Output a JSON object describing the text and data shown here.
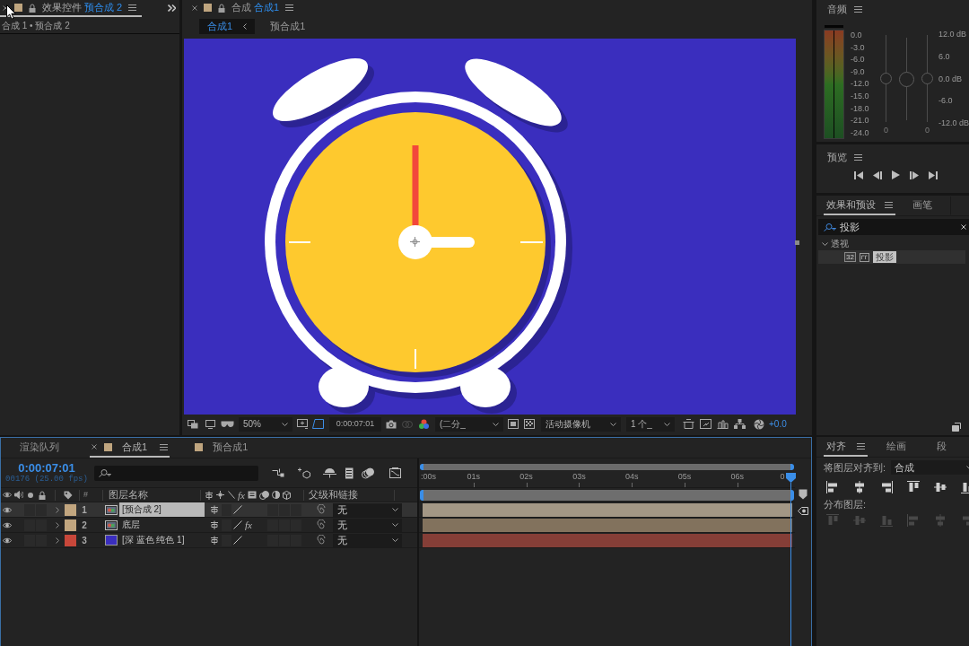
{
  "effect_controls": {
    "title": "效果控件",
    "target": "预合成 2",
    "selected": true,
    "breadcrumb": "合成 1 • 预合成 2"
  },
  "composition": {
    "title": "合成",
    "target": "合成1",
    "selected": false,
    "tabs": [
      {
        "label": "合成1",
        "selected": true
      },
      {
        "label": "预合成1",
        "selected": false
      }
    ],
    "toolbar": {
      "zoom": "50%",
      "timecode": "0:00:07:01",
      "resolution": "(二分_",
      "camera": "活动摄像机",
      "views": "1 个_",
      "exposure": "+0.0"
    }
  },
  "audio": {
    "title": "音频",
    "meter_scale": [
      "0.0",
      "-3.0",
      "-6.0",
      "-9.0",
      "-12.0",
      "-15.0",
      "-18.0",
      "-21.0",
      "-24.0"
    ],
    "sliders": [
      {
        "kind": "channel",
        "level": 0.5,
        "value": "0"
      },
      {
        "kind": "master",
        "level": 0.5
      },
      {
        "kind": "channel",
        "level": 0.5,
        "value": "0"
      }
    ],
    "gain_scale": [
      "12.0 dB",
      "6.0",
      "0.0 dB",
      "-6.0",
      "-12.0 dB"
    ]
  },
  "preview": {
    "title": "预览"
  },
  "effects_presets": {
    "tabs": [
      {
        "label": "效果和预设",
        "selected": true
      },
      {
        "label": "画笔",
        "selected": false
      }
    ],
    "search": {
      "value": "投影"
    },
    "tree": [
      {
        "label": "透视",
        "expanded": true,
        "children": [
          {
            "label": "投影",
            "badge": "32",
            "selected": true
          }
        ]
      }
    ]
  },
  "timeline": {
    "tabs": [
      {
        "label": "渲染队列",
        "kind": "queue",
        "selected": false
      },
      {
        "label": "合成1",
        "kind": "comp",
        "selected": true
      },
      {
        "label": "预合成1",
        "kind": "comp",
        "selected": false
      }
    ],
    "timecode": "0:00:07:01",
    "frame_info": "00176 (25.00 fps)",
    "columns": {
      "number": "#",
      "name": "图层名称",
      "fx": "fx",
      "parent": "父级和链接"
    },
    "layers": [
      {
        "number": "1",
        "name": "[预合成 2]",
        "color": "#c2a67f",
        "source": {
          "kind": "comp"
        },
        "selected": true,
        "parent": "无"
      },
      {
        "number": "2",
        "name": "底层",
        "color": "#c2a67f",
        "source": {
          "kind": "comp"
        },
        "selected": false,
        "fx": {
          "label": "fx",
          "on": true
        },
        "parent": "无"
      },
      {
        "number": "3",
        "name": "[深 蓝色 纯色 1]",
        "color": "#c8473a",
        "source": {
          "kind": "solid",
          "color": "#3a2ebe"
        },
        "selected": false,
        "parent": "无"
      }
    ],
    "ruler": [
      ":00s",
      "01s",
      "02s",
      "03s",
      "04s",
      "05s",
      "06s",
      "0"
    ],
    "playhead": {
      "level": 0.988
    }
  },
  "align": {
    "tabs": [
      {
        "label": "对齐",
        "selected": true
      },
      {
        "label": "绘画",
        "selected": false
      },
      {
        "label": "段",
        "selected": false
      }
    ],
    "align_to_label": "将图层对齐到:",
    "align_to": "合成",
    "distribute_label": "分布图层:",
    "distribute_disabled": true
  }
}
